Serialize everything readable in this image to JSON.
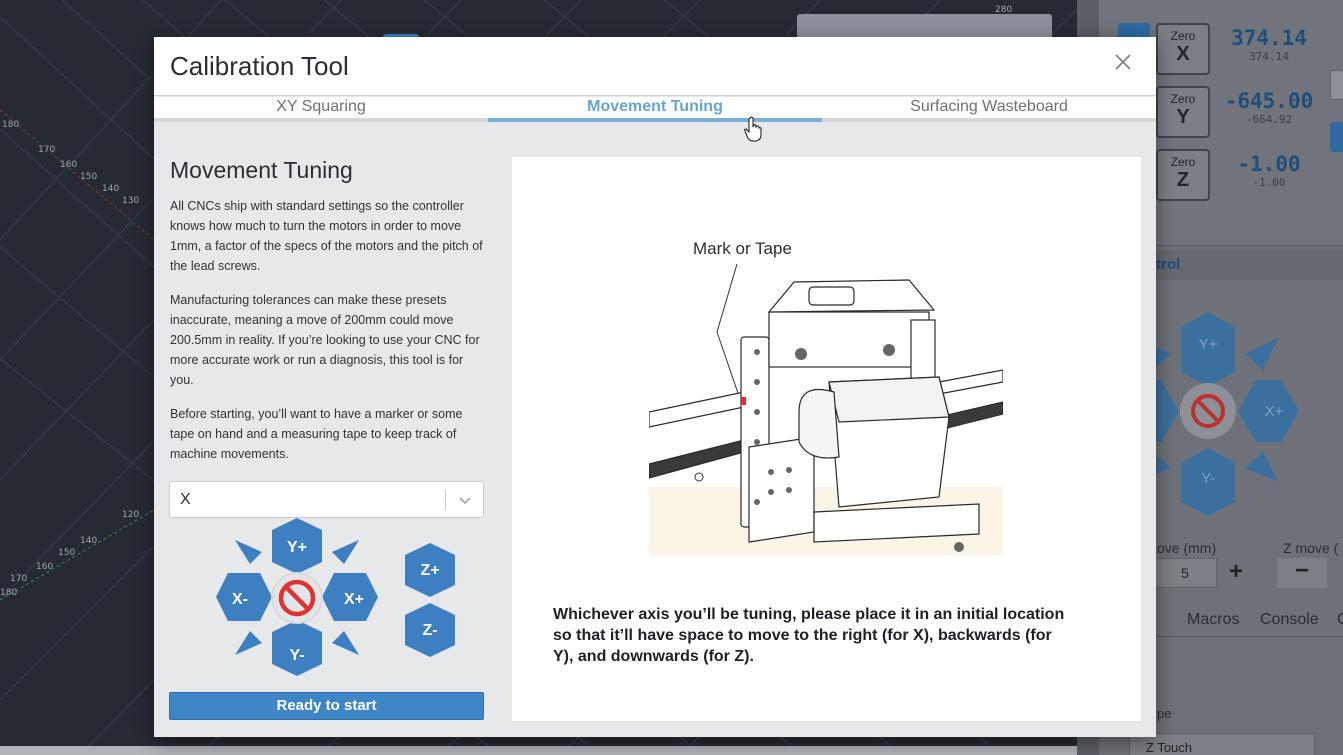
{
  "modal": {
    "title": "Calibration Tool",
    "close_icon": "close-icon",
    "tabs": [
      {
        "label": "XY Squaring",
        "active": false
      },
      {
        "label": "Movement Tuning",
        "active": true
      },
      {
        "label": "Surfacing Wasteboard",
        "active": false
      }
    ]
  },
  "tuning": {
    "title": "Movement Tuning",
    "paragraphs": [
      "All CNCs ship with standard settings so the controller knows how much to turn the motors in order to move 1mm, a factor of the specs of the motors and the pitch of the lead screws.",
      "Manufacturing tolerances can make these presets inaccurate, meaning a move of 200mm could move 200.5mm in reality. If you’re looking to use your CNC for more accurate work or run a diagnosis, this tool is for you.",
      "Before starting, you’ll want to have a marker or some tape on hand and a measuring tape to keep track of machine movements."
    ],
    "axis_select": {
      "value": "X"
    },
    "jog": {
      "y_plus": "Y+",
      "y_minus": "Y-",
      "x_plus": "X+",
      "x_minus": "X-",
      "z_plus": "Z+",
      "z_minus": "Z-",
      "stop_icon": "stop-icon"
    },
    "ready_button": "Ready to start",
    "illustration_label": "Mark or Tape",
    "instruction": "Whichever axis you’ll be tuning, please place it in an initial location so that it’ll have space to move to the right (for X), backwards (for Y), and downwards (for Z)."
  },
  "background": {
    "zero_label": "Zero",
    "axes": [
      {
        "axis": "X",
        "value": "374.14",
        "machine": "374.14"
      },
      {
        "axis": "Y",
        "value": "-645.00",
        "machine": "-664.92"
      },
      {
        "axis": "Z",
        "value": "-1.00",
        "machine": "-1.00"
      }
    ],
    "jog_title": "Control",
    "jog": {
      "y_plus": "Y+",
      "y_minus": "Y-",
      "x_plus": "X+",
      "x_minus": "X-"
    },
    "xy_move_label": "ove (mm)",
    "z_move_label": "Z move (",
    "move_value": "5",
    "plus": "+",
    "minus": "−",
    "tabs": [
      "e",
      "Macros",
      "Console",
      "C"
    ],
    "probe_type_label": "pe",
    "probe_type_value": "Z Touch",
    "grid_labels": [
      "280",
      "180",
      "170",
      "160",
      "150",
      "140",
      "130",
      "120",
      "140",
      "150",
      "160",
      "170",
      "180"
    ]
  },
  "colors": {
    "accent": "#3f86c6",
    "tab_active": "#79aed8",
    "jog_blue": "#3d7fc1",
    "stop_red": "#d33",
    "modal_bg": "#e7e8ea"
  }
}
